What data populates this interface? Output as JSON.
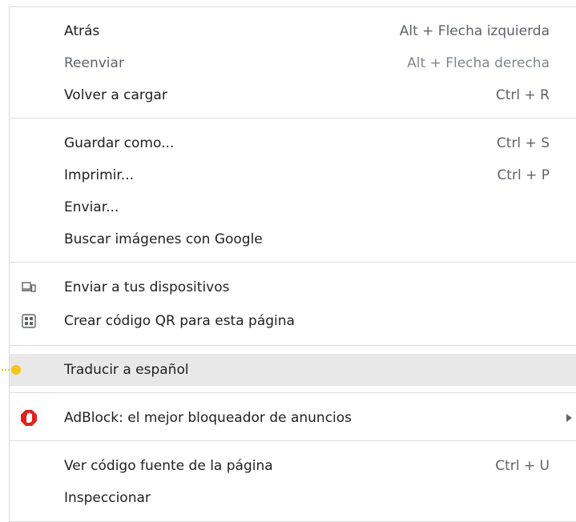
{
  "menu": {
    "items": {
      "back": {
        "label": "Atrás",
        "shortcut": "Alt + Flecha izquierda"
      },
      "forward": {
        "label": "Reenviar",
        "shortcut": "Alt + Flecha derecha"
      },
      "reload": {
        "label": "Volver a cargar",
        "shortcut": "Ctrl + R"
      },
      "save_as": {
        "label": "Guardar como...",
        "shortcut": "Ctrl + S"
      },
      "print": {
        "label": "Imprimir...",
        "shortcut": "Ctrl + P"
      },
      "cast": {
        "label": "Enviar..."
      },
      "search_images": {
        "label": "Buscar imágenes con Google"
      },
      "send_devices": {
        "label": "Enviar a tus dispositivos",
        "icon": "devices-icon"
      },
      "qr_code": {
        "label": "Crear código QR para esta página",
        "icon": "qr-code-icon"
      },
      "translate": {
        "label": "Traducir a español"
      },
      "adblock": {
        "label": "AdBlock: el mejor bloqueador de anuncios",
        "icon": "adblock-icon"
      },
      "view_source": {
        "label": "Ver código fuente de la página",
        "shortcut": "Ctrl + U"
      },
      "inspect": {
        "label": "Inspeccionar"
      }
    }
  },
  "colors": {
    "hover_bg": "#e8e8e8",
    "adblock_red": "#e0201e",
    "cursor_yellow": "#f5c518"
  }
}
